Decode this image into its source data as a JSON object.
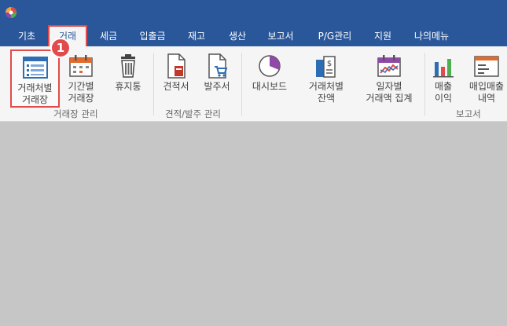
{
  "menu": {
    "items": [
      {
        "label": "기초"
      },
      {
        "label": "거래"
      },
      {
        "label": "세금"
      },
      {
        "label": "입출금"
      },
      {
        "label": "재고"
      },
      {
        "label": "생산"
      },
      {
        "label": "보고서"
      },
      {
        "label": "P/G관리"
      },
      {
        "label": "지원"
      },
      {
        "label": "나의메뉴"
      }
    ],
    "active_index": 1
  },
  "callout": {
    "number": "1"
  },
  "ribbon": {
    "buttons": {
      "ledger_by_client": "거래처별\n거래장",
      "ledger_by_period": "기간별\n거래장",
      "trash": "휴지통",
      "estimate": "견적서",
      "purchase_order": "발주서",
      "dashboard": "대시보드",
      "balance_by_client": "거래처별\n잔액",
      "daily_total": "일자별\n거래액 집계",
      "sales_profit": "매출\n이익",
      "purchase_sales_detail": "매입매출\n내역"
    },
    "groups": {
      "ledger": "거래장 관리",
      "estimate_order": "견적/발주 관리",
      "report": "보고서"
    }
  },
  "colors": {
    "titlebar": "#2a579a",
    "ribbon_bg": "#f5f5f5",
    "highlight": "#e24b4b",
    "workspace": "#c6c6c6"
  }
}
